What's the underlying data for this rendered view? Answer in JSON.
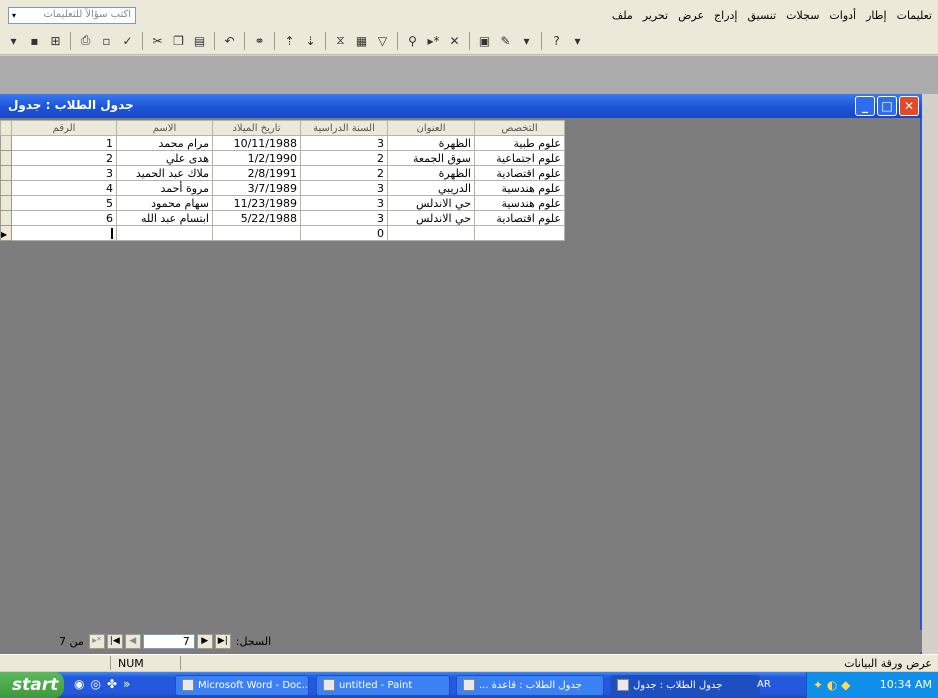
{
  "menu": [
    "ملف",
    "تحرير",
    "عرض",
    "إدراج",
    "تنسيق",
    "سجلات",
    "أدوات",
    "إطار",
    "تعليمات"
  ],
  "help_placeholder": "اكتب سؤالاً للتعليمات",
  "window": {
    "title": "جدول الطلاب : جدول"
  },
  "table": {
    "columns": [
      "الرقم",
      "الاسم",
      "تاريخ الميلاد",
      "السنة الدراسية",
      "العنوان",
      "التخصص"
    ],
    "rows": [
      [
        "1",
        "مرام محمد",
        "10/11/1988",
        "3",
        "الظهرة",
        "علوم طبية"
      ],
      [
        "2",
        "هدى علي",
        "1/2/1990",
        "2",
        "سوق الجمعة",
        "علوم اجتماعية"
      ],
      [
        "3",
        "ملاك عبد الحميد",
        "2/8/1991",
        "2",
        "الظهرة",
        "علوم اقتصادية"
      ],
      [
        "4",
        "مروة أحمد",
        "3/7/1989",
        "3",
        "الدريبي",
        "علوم هندسية"
      ],
      [
        "5",
        "سهام محمود",
        "11/23/1989",
        "3",
        "حي الاندلس",
        "علوم هندسية"
      ],
      [
        "6",
        "ابتسام عبد الله",
        "5/22/1988",
        "3",
        "حي الاندلس",
        "علوم اقتصادية"
      ]
    ],
    "new_row": {
      "year": "0"
    }
  },
  "navigator": {
    "label": "السجل:",
    "current": "7",
    "of_text": "من 7"
  },
  "status": {
    "text": "عرض ورقة البيانات",
    "num": "NUM"
  },
  "taskbar": {
    "start": "start",
    "tasks": [
      "Microsoft Word - Doc...",
      "untitled - Paint",
      "... جدول الطلاب : قاعدة",
      "جدول الطلاب : جدول"
    ],
    "lang": "AR",
    "clock": "10:34 AM"
  }
}
